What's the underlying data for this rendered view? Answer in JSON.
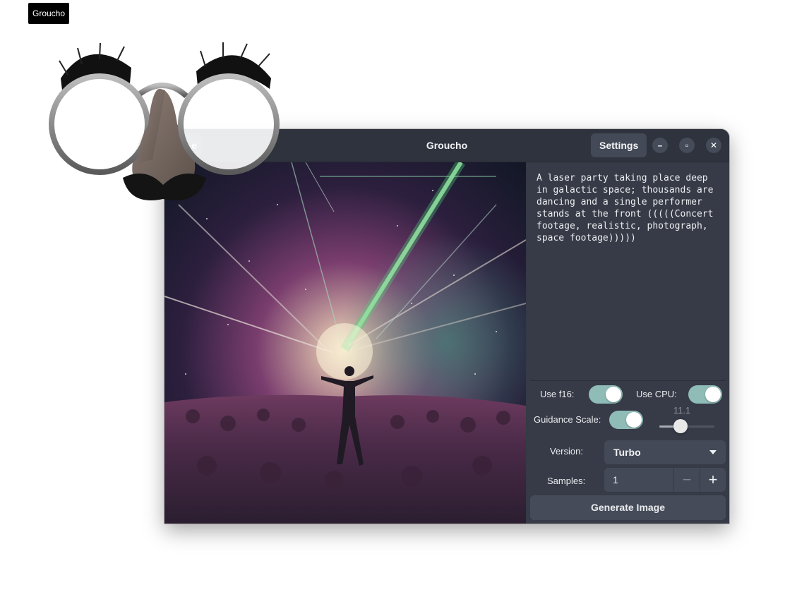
{
  "tooltip": {
    "text": "Groucho"
  },
  "window": {
    "title": "Groucho",
    "header": {
      "save_label": "e",
      "settings_label": "Settings"
    }
  },
  "prompt": {
    "text": "A laser party taking place deep in galactic space; thousands are dancing and a single performer stands at the front (((((Concert footage, realistic, photograph, space footage)))))"
  },
  "options": {
    "use_f16_label": "Use f16:",
    "use_f16_on": true,
    "use_cpu_label": "Use CPU:",
    "use_cpu_on": true,
    "guidance_label": "Guidance Scale:",
    "guidance_on": true,
    "guidance_value": "11.1",
    "version_label": "Version:",
    "version_value": "Turbo",
    "samples_label": "Samples:",
    "samples_value": "1"
  },
  "generate_label": "Generate Image",
  "colors": {
    "window_bg": "#343945",
    "switch_on": "#8fbcb6",
    "button_bg": "#434956"
  }
}
